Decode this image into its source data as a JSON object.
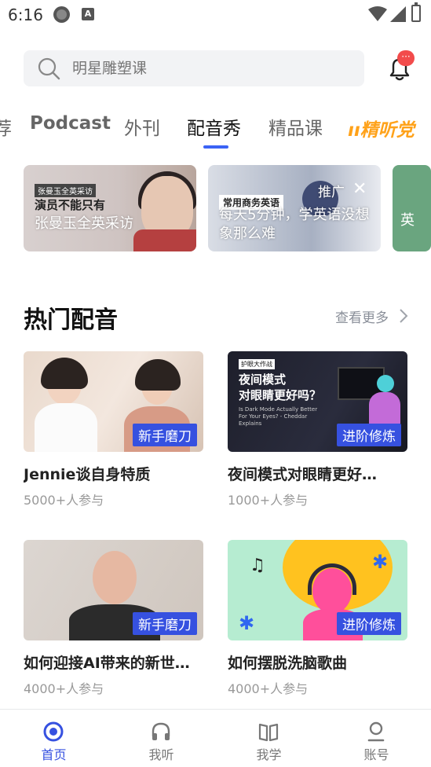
{
  "status_bar": {
    "time": "6:16"
  },
  "search": {
    "placeholder": "明星雕塑课"
  },
  "tabs": [
    {
      "label": "荐"
    },
    {
      "label": "Podcast"
    },
    {
      "label": "外刊"
    },
    {
      "label": "配音秀"
    },
    {
      "label": "精品课"
    }
  ],
  "tab_logo": "精听党",
  "banners": [
    {
      "tag": "张曼玉全英采访",
      "quote": "演员不能只有",
      "title": "张曼玉全英采访"
    },
    {
      "tag": "常用商务英语",
      "title": "每天5分钟，学英语没想象那么难",
      "overlay_text": "推广"
    },
    {
      "title": "英"
    }
  ],
  "section": {
    "title": "热门配音",
    "see_more": "查看更多"
  },
  "cards": [
    {
      "title": "Jennie谈自身特质",
      "meta": "5000+人参与",
      "badge": "新手磨刀"
    },
    {
      "title": "夜间模式对眼睛更好…",
      "meta": "1000+人参与",
      "badge": "进阶修炼",
      "thumb_tag": "护眼大作战",
      "thumb_title": "夜间模式\n对眼睛更好吗？",
      "thumb_sub": "Is Dark Mode Actually Better For Your Eyes? - Cheddar Explains"
    },
    {
      "title": "如何迎接AI带来的新世…",
      "meta": "4000+人参与",
      "badge": "新手磨刀"
    },
    {
      "title": "如何摆脱洗脑歌曲",
      "meta": "4000+人参与",
      "badge": "进阶修炼"
    }
  ],
  "bottom_nav": [
    {
      "label": "首页",
      "active": true
    },
    {
      "label": "我听",
      "active": false
    },
    {
      "label": "我学",
      "active": false
    },
    {
      "label": "账号",
      "active": false
    }
  ],
  "colors": {
    "accent": "#3651e0",
    "tab_indicator": "#3b63f5",
    "logo_orange": "#ffa21a",
    "badge_red": "#f24b4b"
  }
}
